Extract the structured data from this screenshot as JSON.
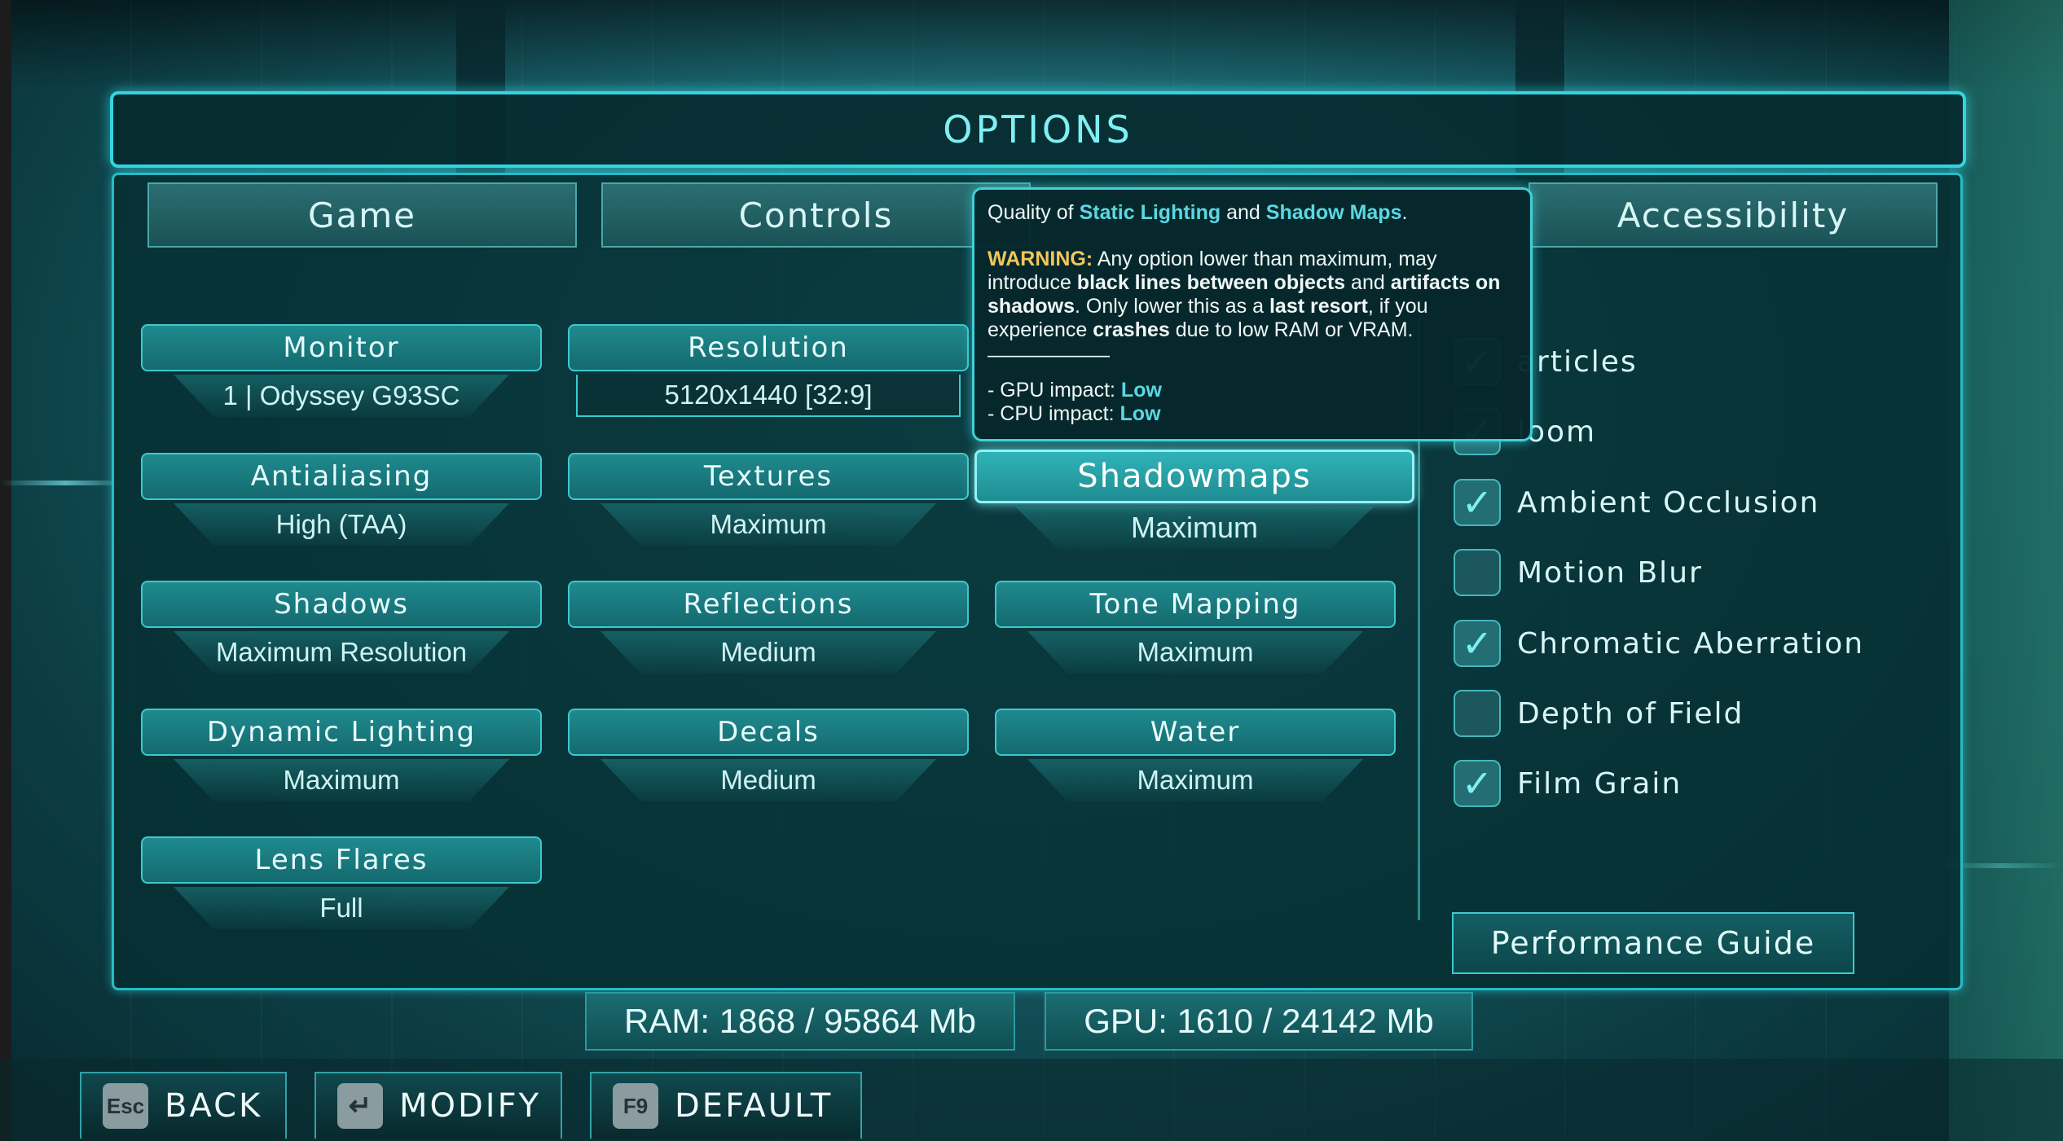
{
  "title": "OPTIONS",
  "tabs": [
    "Game",
    "Controls",
    "Accessibility"
  ],
  "options": {
    "monitor": {
      "label": "Monitor",
      "value": "1 | Odyssey G93SC"
    },
    "resolution": {
      "label": "Resolution",
      "value": "5120x1440 [32:9]"
    },
    "antialiasing": {
      "label": "Antialiasing",
      "value": "High (TAA)"
    },
    "textures": {
      "label": "Textures",
      "value": "Maximum"
    },
    "shadowmaps": {
      "label": "Shadowmaps",
      "value": "Maximum"
    },
    "shadows": {
      "label": "Shadows",
      "value": "Maximum Resolution"
    },
    "reflections": {
      "label": "Reflections",
      "value": "Medium"
    },
    "tone_mapping": {
      "label": "Tone Mapping",
      "value": "Maximum"
    },
    "dynamic_lighting": {
      "label": "Dynamic Lighting",
      "value": "Maximum"
    },
    "decals": {
      "label": "Decals",
      "value": "Medium"
    },
    "water": {
      "label": "Water",
      "value": "Maximum"
    },
    "lens_flares": {
      "label": "Lens Flares",
      "value": "Full"
    }
  },
  "effects": [
    {
      "label": "articles",
      "checked": true
    },
    {
      "label": "loom",
      "checked": true
    },
    {
      "label": "Ambient Occlusion",
      "checked": true
    },
    {
      "label": "Motion Blur",
      "checked": false
    },
    {
      "label": "Chromatic Aberration",
      "checked": true
    },
    {
      "label": "Depth of Field",
      "checked": false
    },
    {
      "label": "Film Grain",
      "checked": true
    }
  ],
  "performance_guide": "Performance Guide",
  "stats": {
    "ram": "RAM: 1868 / 95864 Mb",
    "gpu": "GPU: 1610 / 24142 Mb"
  },
  "tooltip": {
    "t1": "Quality of ",
    "t2": "Static Lighting",
    "t3": " and ",
    "t4": "Shadow Maps",
    "t5": ".",
    "warning_label": "WARNING:",
    "w1": " Any option lower than maximum, may introduce ",
    "w2": "black lines between objects",
    "w3": " and ",
    "w4": "artifacts on shadows",
    "w5": ". Only lower this as a ",
    "w6": "last resort",
    "w7": ", if you experience ",
    "w8": "crashes",
    "w9": " due to low RAM or VRAM.",
    "separator": "——————",
    "gpu_label": "- GPU impact: ",
    "gpu_value": "Low",
    "cpu_label": "- CPU impact: ",
    "cpu_value": "Low"
  },
  "footer": [
    {
      "key": "Esc",
      "label": "BACK"
    },
    {
      "key": "↵",
      "label": "MODIFY"
    },
    {
      "key": "F9",
      "label": "DEFAULT"
    }
  ],
  "colors": {
    "accent": "#34d4de",
    "highlight": "#5ad8e2",
    "warning": "#f2c65a"
  }
}
